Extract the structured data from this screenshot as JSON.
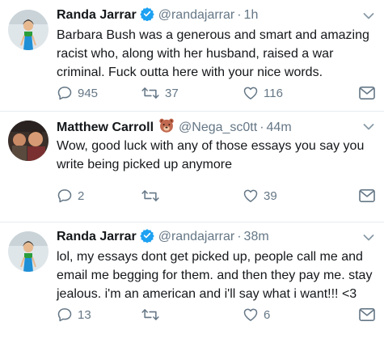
{
  "tweets": [
    {
      "name": "Randa Jarrar",
      "handle": "@randajarrar",
      "separator": "·",
      "time": "1h",
      "verified": true,
      "badge": null,
      "text": "Barbara Bush was a generous and smart and amazing racist who, along with her husband, raised a war criminal. Fuck outta here with your nice words.",
      "replies": "945",
      "retweets": "37",
      "likes": "116"
    },
    {
      "name": "Matthew Carroll",
      "handle": "@Nega_sc0tt",
      "separator": "·",
      "time": "44m",
      "verified": false,
      "badge": "bear-emoji",
      "text": "Wow,  good luck with any of those essays you say you write being picked up anymore",
      "replies": "2",
      "retweets": "",
      "likes": "39"
    },
    {
      "name": "Randa Jarrar",
      "handle": "@randajarrar",
      "separator": "·",
      "time": "38m",
      "verified": true,
      "badge": null,
      "text": "lol, my essays dont get picked up, people call me and email me begging for them. and then they pay me. stay jealous. i'm an american and i'll say what i want!!! <3",
      "replies": "13",
      "retweets": "",
      "likes": "6"
    }
  ],
  "colors": {
    "text": "#14171a",
    "muted": "#657786",
    "verified": "#1da1f2",
    "divider": "#e6ecf0"
  },
  "icons": [
    "verified-badge-icon",
    "chevron-down-icon",
    "reply-icon",
    "retweet-icon",
    "like-icon",
    "message-icon",
    "bear-emoji-icon"
  ]
}
